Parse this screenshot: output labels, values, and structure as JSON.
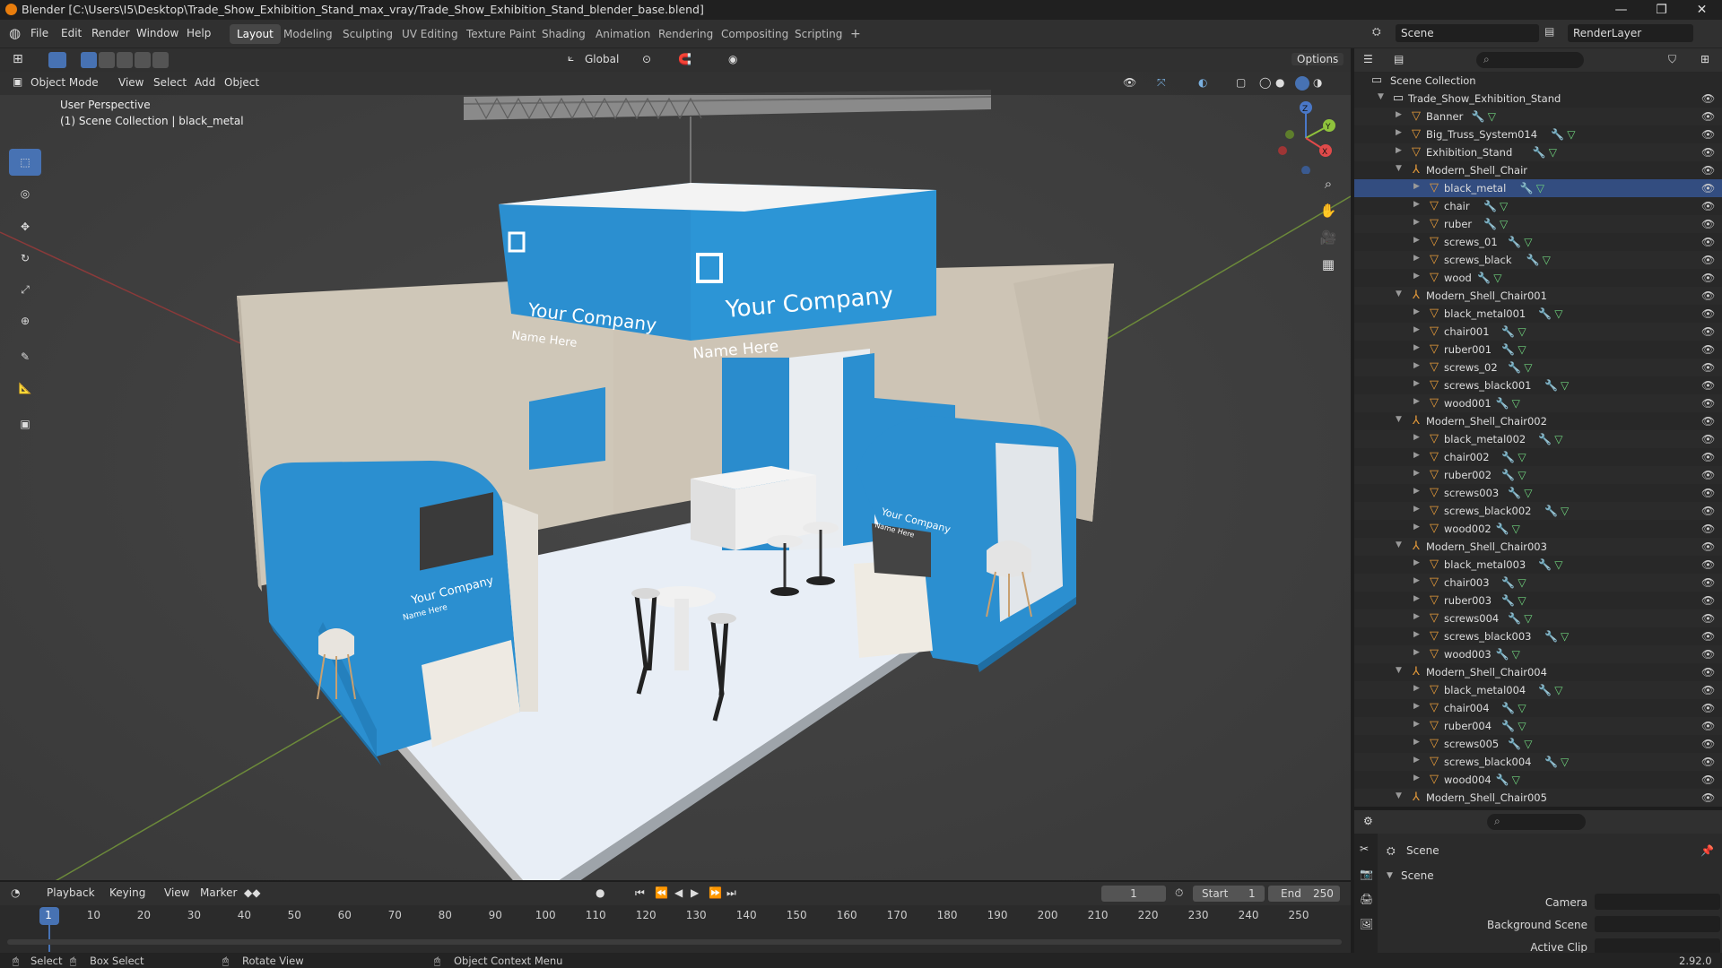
{
  "window": {
    "title": "Blender [C:\\Users\\I5\\Desktop\\Trade_Show_Exhibition_Stand_max_vray/Trade_Show_Exhibition_Stand_blender_base.blend]",
    "minimize": "—",
    "maximize": "❐",
    "close": "✕"
  },
  "menus": [
    "File",
    "Edit",
    "Render",
    "Window",
    "Help"
  ],
  "workspaces": [
    "Layout",
    "Modeling",
    "Sculpting",
    "UV Editing",
    "Texture Paint",
    "Shading",
    "Animation",
    "Rendering",
    "Compositing",
    "Scripting"
  ],
  "add_workspace": "+",
  "scene_selector": {
    "scene": "Scene",
    "render_layer": "RenderLayer"
  },
  "viewport_header": {
    "transform_orientation": "Global",
    "options": "Options",
    "mode": "Object Mode",
    "menus": [
      "View",
      "Select",
      "Add",
      "Object"
    ]
  },
  "viewport": {
    "perspective": "User Perspective",
    "collection_info": "(1) Scene Collection | black_metal",
    "gizmo_axes": {
      "z": "Z",
      "y": "Y",
      "x": "X"
    }
  },
  "scene_text": {
    "company": "Your Company",
    "name": "Name Here"
  },
  "outliner": {
    "root": "Scene Collection",
    "rows": [
      {
        "label": "Trade_Show_Exhibition_Stand",
        "type": "collection",
        "depth": 0,
        "expanded": true
      },
      {
        "label": "Banner",
        "type": "object",
        "depth": 1
      },
      {
        "label": "Big_Truss_System014",
        "type": "object",
        "depth": 1
      },
      {
        "label": "Exhibition_Stand",
        "type": "object",
        "depth": 1
      },
      {
        "label": "Modern_Shell_Chair",
        "type": "empty",
        "depth": 1,
        "expanded": true
      },
      {
        "label": "black_metal",
        "type": "object",
        "depth": 2,
        "selected": true
      },
      {
        "label": "chair",
        "type": "object",
        "depth": 2
      },
      {
        "label": "ruber",
        "type": "object",
        "depth": 2
      },
      {
        "label": "screws_01",
        "type": "object",
        "depth": 2
      },
      {
        "label": "screws_black",
        "type": "object",
        "depth": 2
      },
      {
        "label": "wood",
        "type": "object",
        "depth": 2
      },
      {
        "label": "Modern_Shell_Chair001",
        "type": "empty",
        "depth": 1,
        "expanded": true
      },
      {
        "label": "black_metal001",
        "type": "object",
        "depth": 2
      },
      {
        "label": "chair001",
        "type": "object",
        "depth": 2
      },
      {
        "label": "ruber001",
        "type": "object",
        "depth": 2
      },
      {
        "label": "screws_02",
        "type": "object",
        "depth": 2
      },
      {
        "label": "screws_black001",
        "type": "object",
        "depth": 2
      },
      {
        "label": "wood001",
        "type": "object",
        "depth": 2
      },
      {
        "label": "Modern_Shell_Chair002",
        "type": "empty",
        "depth": 1,
        "expanded": true
      },
      {
        "label": "black_metal002",
        "type": "object",
        "depth": 2
      },
      {
        "label": "chair002",
        "type": "object",
        "depth": 2
      },
      {
        "label": "ruber002",
        "type": "object",
        "depth": 2
      },
      {
        "label": "screws003",
        "type": "object",
        "depth": 2
      },
      {
        "label": "screws_black002",
        "type": "object",
        "depth": 2
      },
      {
        "label": "wood002",
        "type": "object",
        "depth": 2
      },
      {
        "label": "Modern_Shell_Chair003",
        "type": "empty",
        "depth": 1,
        "expanded": true
      },
      {
        "label": "black_metal003",
        "type": "object",
        "depth": 2
      },
      {
        "label": "chair003",
        "type": "object",
        "depth": 2
      },
      {
        "label": "ruber003",
        "type": "object",
        "depth": 2
      },
      {
        "label": "screws004",
        "type": "object",
        "depth": 2
      },
      {
        "label": "screws_black003",
        "type": "object",
        "depth": 2
      },
      {
        "label": "wood003",
        "type": "object",
        "depth": 2
      },
      {
        "label": "Modern_Shell_Chair004",
        "type": "empty",
        "depth": 1,
        "expanded": true
      },
      {
        "label": "black_metal004",
        "type": "object",
        "depth": 2
      },
      {
        "label": "chair004",
        "type": "object",
        "depth": 2
      },
      {
        "label": "ruber004",
        "type": "object",
        "depth": 2
      },
      {
        "label": "screws005",
        "type": "object",
        "depth": 2
      },
      {
        "label": "screws_black004",
        "type": "object",
        "depth": 2
      },
      {
        "label": "wood004",
        "type": "object",
        "depth": 2
      },
      {
        "label": "Modern_Shell_Chair005",
        "type": "empty",
        "depth": 1,
        "expanded": true
      }
    ]
  },
  "properties": {
    "context": "Scene",
    "panel": "Scene",
    "fields": [
      {
        "label": "Camera",
        "value": ""
      },
      {
        "label": "Background Scene",
        "value": ""
      },
      {
        "label": "Active Clip",
        "value": ""
      }
    ]
  },
  "timeline": {
    "menus": [
      "Playback",
      "Keying",
      "View",
      "Marker"
    ],
    "current_frame": "1",
    "start_label": "Start",
    "start": "1",
    "end_label": "End",
    "end": "250",
    "ticks": [
      "1",
      "10",
      "20",
      "30",
      "40",
      "50",
      "60",
      "70",
      "80",
      "90",
      "100",
      "110",
      "120",
      "130",
      "140",
      "150",
      "160",
      "170",
      "180",
      "190",
      "200",
      "210",
      "220",
      "230",
      "240",
      "250"
    ]
  },
  "statusbar": {
    "select": "Select",
    "box_select": "Box Select",
    "rotate_view": "Rotate View",
    "context_menu": "Object Context Menu",
    "version": "2.92.0"
  },
  "colors": {
    "accent": "#4772b3",
    "booth_blue": "#2b8fd0",
    "floor": "#e6edf5",
    "wall": "#d8d0c2"
  }
}
